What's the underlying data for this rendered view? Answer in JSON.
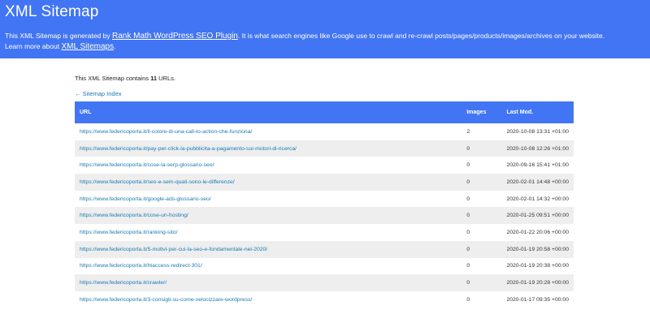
{
  "header": {
    "title": "XML Sitemap",
    "desc_prefix": "This XML Sitemap is generated by ",
    "desc_link": "Rank Math WordPress SEO Plugin",
    "desc_suffix": ". It is what search engines like Google use to crawl and re-crawl posts/pages/products/images/archives on your website.",
    "learn_prefix": "Learn more about ",
    "learn_link": "XML Sitemaps",
    "learn_suffix": "."
  },
  "summary": {
    "prefix": "This XML Sitemap contains ",
    "count": "11",
    "suffix": " URLs."
  },
  "index_link": "← Sitemap Index",
  "table": {
    "headers": {
      "url": "URL",
      "images": "Images",
      "lastmod": "Last Mod."
    },
    "rows": [
      {
        "url": "https://www.federicoporta.it/il-colore-di-una-call-to-action-che-funziona/",
        "images": "2",
        "lastmod": "2020-10-08 13:31 +01:00"
      },
      {
        "url": "https://www.federicoporta.it/pay-per-click-la-pubblicita-a-pagamento-sui-motori-di-ricerca/",
        "images": "0",
        "lastmod": "2020-10-08 12:26 +01:00"
      },
      {
        "url": "https://www.federicoporta.it/cose-la-serp-glossario-seo/",
        "images": "0",
        "lastmod": "2020-09-16 15:41 +01:00"
      },
      {
        "url": "https://www.federicoporta.it/seo-e-sem-quali-sono-le-differenze/",
        "images": "0",
        "lastmod": "2020-02-01 14:48 +00:00"
      },
      {
        "url": "https://www.federicoporta.it/google-ads-glossario-seo/",
        "images": "0",
        "lastmod": "2020-02-01 14:32 +00:00"
      },
      {
        "url": "https://www.federicoporta.it/cose-un-hosting/",
        "images": "0",
        "lastmod": "2020-01-25 09:51 +00:00"
      },
      {
        "url": "https://www.federicoporta.it/ranking-sito/",
        "images": "0",
        "lastmod": "2020-01-22 20:06 +00:00"
      },
      {
        "url": "https://www.federicoporta.it/5-motivi-per-cui-la-seo-e-fondamentale-nel-2020/",
        "images": "0",
        "lastmod": "2020-01-19 20:58 +00:00"
      },
      {
        "url": "https://www.federicoporta.it/htaccess-redirect-301/",
        "images": "0",
        "lastmod": "2020-01-19 20:38 +00:00"
      },
      {
        "url": "https://www.federicoporta.it/crawler/",
        "images": "0",
        "lastmod": "2020-01-19 20:28 +00:00"
      },
      {
        "url": "https://www.federicoporta.it/3-consigli-su-come-velocizzare-wordpress/",
        "images": "0",
        "lastmod": "2020-01-17 09:35 +00:00"
      }
    ]
  }
}
